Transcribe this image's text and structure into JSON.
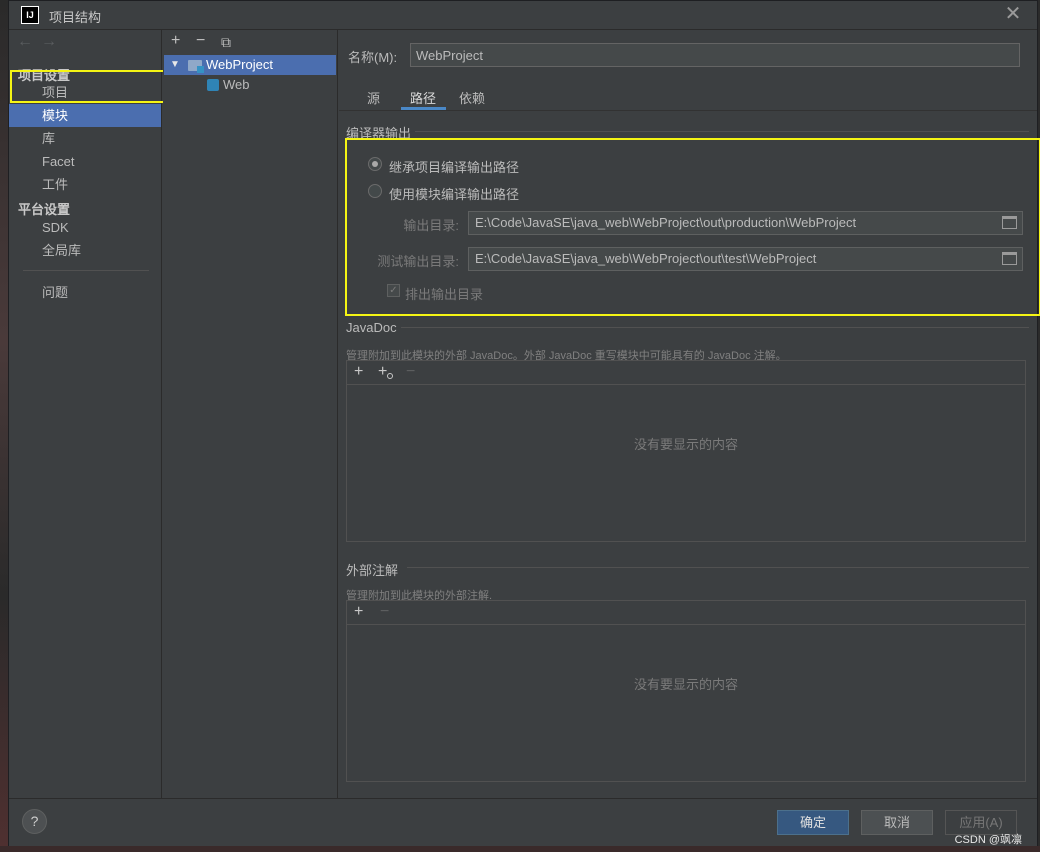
{
  "window": {
    "title": "项目结构",
    "logo_text": "IJ",
    "close_icon": "✕"
  },
  "left_nav": {
    "back_icon": "←",
    "forward_icon": "→",
    "project_settings_header": "项目设置",
    "project_settings_items": [
      {
        "label": "项目",
        "selected": false
      },
      {
        "label": "模块",
        "selected": true
      },
      {
        "label": "库",
        "selected": false
      },
      {
        "label": "Facet",
        "selected": false
      },
      {
        "label": "工件",
        "selected": false
      }
    ],
    "platform_settings_header": "平台设置",
    "platform_settings_items": [
      {
        "label": "SDK"
      },
      {
        "label": "全局库"
      }
    ],
    "problems_label": "问题"
  },
  "tree": {
    "toolbar": {
      "add_icon": "+",
      "remove_icon": "−",
      "copy_icon": "⧉"
    },
    "root_label": "WebProject",
    "child_label": "Web"
  },
  "content": {
    "name_label": "名称(M):",
    "name_value": "WebProject",
    "tabs": [
      {
        "label": "源",
        "active": false
      },
      {
        "label": "路径",
        "active": true
      },
      {
        "label": "依赖",
        "active": false
      }
    ],
    "compiler_output": {
      "title": "编译器输出",
      "inherit_label": "继承项目编译输出路径",
      "inherit_checked": true,
      "module_label": "使用模块编译输出路径",
      "module_checked": false,
      "output_dir_label": "输出目录:",
      "output_dir_value": "E:\\Code\\JavaSE\\java_web\\WebProject\\out\\production\\WebProject",
      "test_output_dir_label": "测试输出目录:",
      "test_output_dir_value": "E:\\Code\\JavaSE\\java_web\\WebProject\\out\\test\\WebProject",
      "exclude_label": "排出输出目录",
      "exclude_mark": "✓"
    },
    "javadoc": {
      "title": "JavaDoc",
      "description": "管理附加到此模块的外部 JavaDoc。外部 JavaDoc 重写模块中可能具有的 JavaDoc 注解。",
      "add_icon": "+",
      "add_url_icon": "+",
      "remove_icon": "−",
      "empty_text": "没有要显示的内容"
    },
    "external_annotations": {
      "title": "外部注解",
      "description": "管理附加到此模块的外部注解.",
      "add_icon": "+",
      "remove_icon": "−",
      "empty_text": "没有要显示的内容"
    }
  },
  "footer": {
    "help_icon": "?",
    "ok_label": "确定",
    "cancel_label": "取消",
    "apply_label": "应用(A)",
    "watermark": "CSDN @飒凛"
  },
  "colors": {
    "highlight": "#f5f514",
    "selection": "#4b6eaf",
    "primary_button": "#365880"
  }
}
